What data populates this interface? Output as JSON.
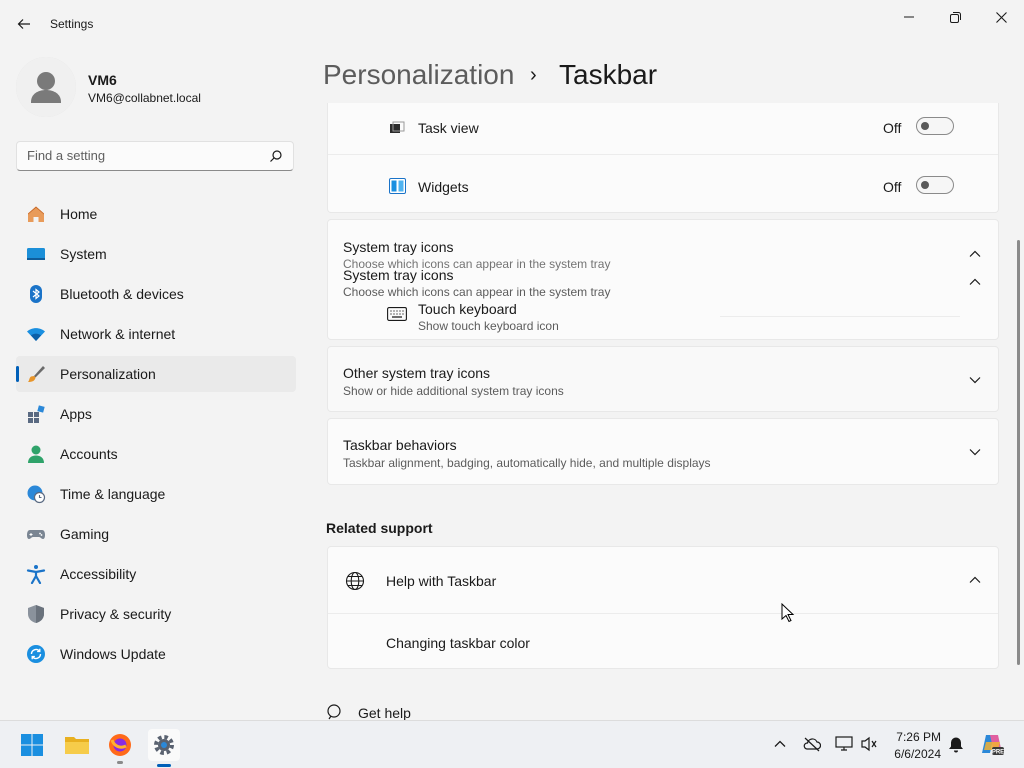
{
  "window": {
    "title": "Settings"
  },
  "user": {
    "name": "VM6",
    "email": "VM6@collabnet.local"
  },
  "search": {
    "placeholder": "Find a setting"
  },
  "nav": [
    {
      "label": "Home",
      "icon": "home-icon"
    },
    {
      "label": "System",
      "icon": "system-icon"
    },
    {
      "label": "Bluetooth & devices",
      "icon": "bluetooth-icon"
    },
    {
      "label": "Network & internet",
      "icon": "wifi-icon"
    },
    {
      "label": "Personalization",
      "icon": "brush-icon",
      "selected": true
    },
    {
      "label": "Apps",
      "icon": "apps-icon"
    },
    {
      "label": "Accounts",
      "icon": "accounts-icon"
    },
    {
      "label": "Time & language",
      "icon": "clock-globe-icon"
    },
    {
      "label": "Gaming",
      "icon": "gamepad-icon"
    },
    {
      "label": "Accessibility",
      "icon": "accessibility-icon"
    },
    {
      "label": "Privacy & security",
      "icon": "shield-icon"
    },
    {
      "label": "Windows Update",
      "icon": "update-icon"
    }
  ],
  "header": {
    "parent": "Personalization",
    "separator": "›",
    "current": "Taskbar"
  },
  "taskbar_items": [
    {
      "label": "Task view",
      "state": "Off",
      "icon": "task-view-icon"
    },
    {
      "label": "Widgets",
      "state": "Off",
      "icon": "widgets-icon"
    }
  ],
  "system_tray": {
    "title": "System tray icons",
    "subtitle": "Choose which icons can appear in the system tray",
    "touch_keyboard": {
      "title": "Touch keyboard",
      "subtitle": "Show touch keyboard icon"
    }
  },
  "other_tray": {
    "title": "Other system tray icons",
    "subtitle": "Show or hide additional system tray icons"
  },
  "behaviors": {
    "title": "Taskbar behaviors",
    "subtitle": "Taskbar alignment, badging, automatically hide, and multiple displays"
  },
  "related": {
    "heading": "Related support",
    "help_title": "Help with Taskbar",
    "link": "Changing taskbar color"
  },
  "get_help": "Get help",
  "clock": {
    "time": "7:26 PM",
    "date": "6/6/2024"
  },
  "colors": {
    "accent": "#005fb8",
    "background": "#f3f3f3",
    "card": "#fbfbfb"
  }
}
